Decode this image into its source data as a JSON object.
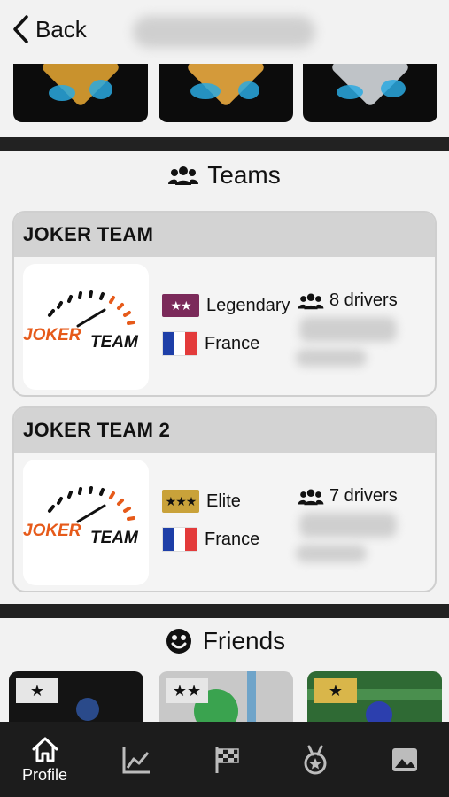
{
  "header": {
    "back_label": "Back"
  },
  "teams_section": {
    "title": "Teams"
  },
  "teams": [
    {
      "name": "JOKER TEAM",
      "level": "Legendary",
      "level_stars": "★★",
      "level_color": "#7b2a5a",
      "country": "France",
      "drivers": "8 drivers",
      "logo_text_1": "JOKER",
      "logo_text_2": "TEAM"
    },
    {
      "name": "JOKER TEAM 2",
      "level": "Elite",
      "level_stars": "★★★",
      "level_color": "#c9a23a",
      "country": "France",
      "drivers": "7 drivers",
      "logo_text_1": "JOKER",
      "logo_text_2": "TEAM"
    }
  ],
  "friends_section": {
    "title": "Friends"
  },
  "friends": [
    {
      "stars": "★",
      "chip_color": "#e6e6e6"
    },
    {
      "stars": "★★",
      "chip_color": "#e6e6e6"
    },
    {
      "stars": "★",
      "chip_color": "#d9b64a"
    }
  ],
  "tabbar": {
    "items": [
      {
        "label": "Profile",
        "icon": "home-icon",
        "active": true
      },
      {
        "label": "",
        "icon": "chart-icon",
        "active": false
      },
      {
        "label": "",
        "icon": "checkered-flag-icon",
        "active": false
      },
      {
        "label": "",
        "icon": "medal-icon",
        "active": false
      },
      {
        "label": "",
        "icon": "image-icon",
        "active": false
      }
    ]
  }
}
